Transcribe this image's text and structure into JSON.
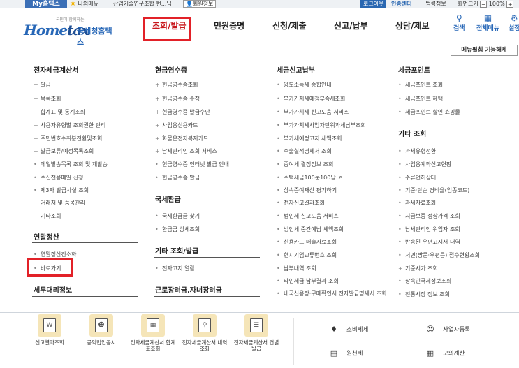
{
  "topbar": {
    "my_hometax": "My홈택스",
    "favorites": "나의메뉴",
    "company": "산업기술연구조합 현...님",
    "member_info": "회원정보",
    "logout": "로그아웃",
    "cert_center": "인증센터",
    "law_info": "법령정보",
    "zoom_label": "화면크기",
    "zoom_out": "−",
    "zoom_value": "100%",
    "zoom_in": "+"
  },
  "header": {
    "logo_sub": "국민이 함께하는",
    "logo_home": "Home",
    "logo_tax": "tax",
    "logo_name": "국세청홈택스",
    "nav": [
      "조회/발급",
      "민원증명",
      "신청/제출",
      "신고/납부",
      "상담/제보"
    ],
    "icons": {
      "search": "검색",
      "all_menu": "전체메뉴",
      "settings": "설정"
    }
  },
  "bubble_button": "메뉴펼침 기능해제",
  "columns": {
    "einvoice": {
      "title": "전자세금계산서",
      "items": [
        "발급",
        "목록조회",
        "합계표 및 통계조회",
        "사용자유형별 조회권한 관리",
        "주민번호수취분전환및조회",
        "발급보류/예정목록조회",
        "메일발송목록 조회 및 재발송",
        "수신전용메일 신청",
        "제3자 발급사실 조회",
        "거래처 및 품목관리",
        "기타조회"
      ]
    },
    "yearend": {
      "title": "연말정산",
      "items": [
        "연말정산간소화",
        "바로가기"
      ]
    },
    "tax_agent": {
      "title": "세무대리정보"
    },
    "cash_receipt": {
      "title": "현금영수증",
      "items": [
        "현금영수증조회",
        "현금영수증 수정",
        "현금영수증 발급수단",
        "사업용신용카드",
        "화물운전자복지카드",
        "납세관리인 조회 서비스",
        "현금영수증 인터넷 발급 안내",
        "현금영수증 발급"
      ]
    },
    "refund": {
      "title": "국세환급",
      "items": [
        "국세환급금 찾기",
        "환급금 상세조회"
      ]
    },
    "etc_issue": {
      "title": "기타 조회/발급",
      "items": [
        "전자고지 열람"
      ]
    },
    "eitc": {
      "title": "근로장려금.자녀장려금"
    },
    "tax_report": {
      "title": "세금신고납부",
      "items": [
        "양도소득세 종합안내",
        "부가가치세예정부족세조회",
        "부가가치세 신고도움 서비스",
        "부가가치세사업자단위과세납부조회",
        "부가세예정고지 세액조회",
        "수출실적명세서 조회",
        "중여세 결정정보 조회",
        "주택세금100문100답",
        "상속증여재산 평가하기",
        "전자신고결과조회",
        "법인세 신고도움 서비스",
        "법인세 중간예납 세액조회",
        "신용카드 매출자료조회",
        "현지기업교류번호 조회",
        "납부내역 조회",
        "타인세금 납부결과 조회",
        "내국신용장·구매확인서 전자발급명세서 조회"
      ]
    },
    "tax_point": {
      "title": "세금포인트",
      "items": [
        "세금포인트 조회",
        "세금포인트 혜택",
        "세금포인트 할인 쇼핑몰"
      ]
    },
    "etc": {
      "title": "기타 조회",
      "items": [
        "과세유형전환",
        "사업용계좌신고현황",
        "주류면허상태",
        "기준·단순 경비율(업종코드)",
        "과세자료조회",
        "지급보증 정상가격 조회",
        "납세관리인 위임자 조회",
        "반송된 우편고지서 내역",
        "서면(방문·우편등) 접수현황조회",
        "기준시가 조회",
        "상속인국세정보조회",
        "전통시장 정보 조회"
      ]
    }
  },
  "quick_links": [
    {
      "label": "신고결과조회"
    },
    {
      "label": "공익법인공시"
    },
    {
      "label": "전자세금계산서 합계표조회"
    },
    {
      "label": "전자세금계산서 내역조회"
    },
    {
      "label": "전자세금계산서 건별발급"
    }
  ],
  "right_links": [
    "소비제세",
    "사업자등록",
    "원천세",
    "모의계산"
  ]
}
